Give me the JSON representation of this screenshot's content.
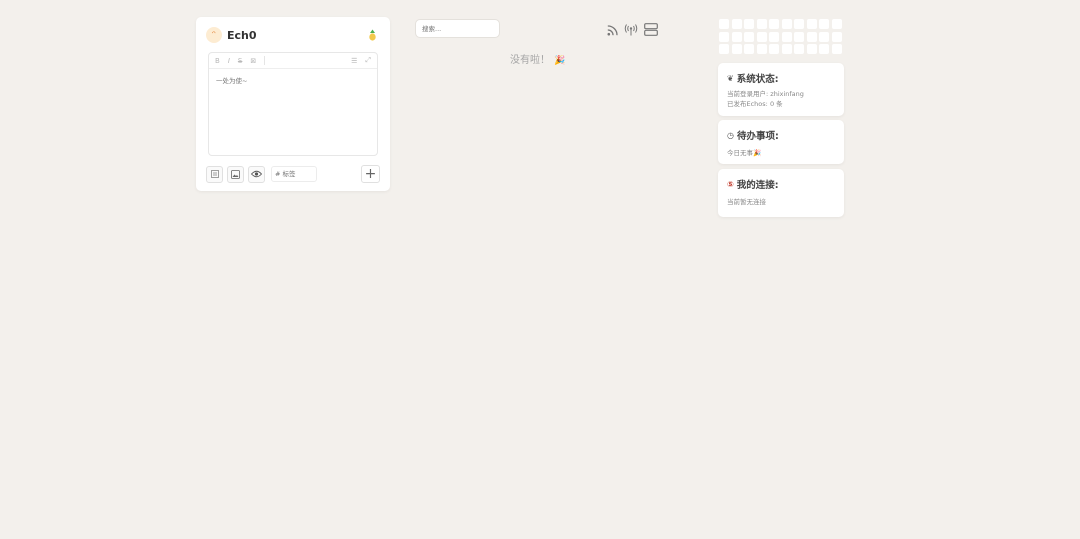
{
  "editor": {
    "title": "Ech0",
    "toolbar": {
      "bold": "B",
      "italic": "I",
      "strike": "S",
      "image": "⊠",
      "list": "☰",
      "expand": "⤢"
    },
    "placeholder_text": "一处为使~",
    "tag_placeholder": "# 标签",
    "add_label": "+"
  },
  "search": {
    "placeholder": "搜索..."
  },
  "feed": {
    "empty_text": "没有啦！",
    "empty_emoji": "🎉"
  },
  "heatmap": {
    "rows": 3,
    "cols": 10
  },
  "status_card": {
    "title": "系统状态:",
    "user_label": "当前登录用户:",
    "user_value": "zhixinfang",
    "echos_label": "已发布Echos:",
    "echos_value": "0",
    "echos_unit": "条"
  },
  "todo_card": {
    "title": "待办事项:",
    "text": "今日无事",
    "emoji": "🎉"
  },
  "links_card": {
    "title": "我的连接:",
    "text": "当前暂无连接"
  },
  "colors": {
    "background": "#f3f0ec",
    "card": "#ffffff",
    "accent_red": "#c0392b"
  }
}
